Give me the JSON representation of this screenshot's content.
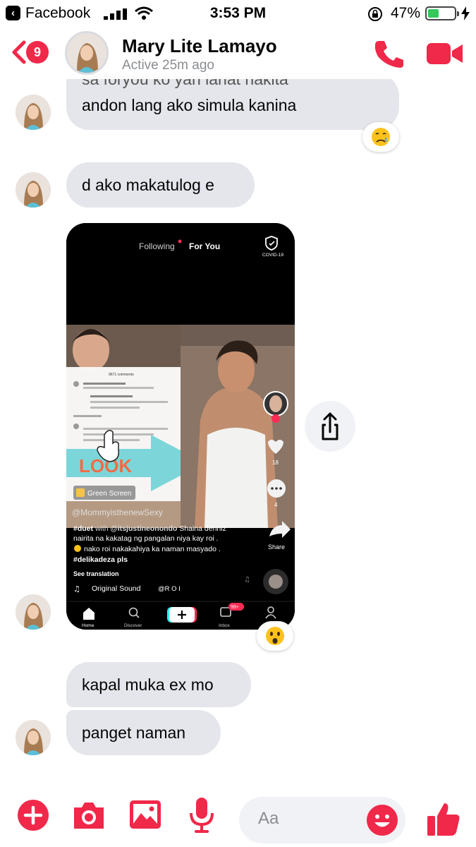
{
  "status_bar": {
    "back_app": "Facebook",
    "time": "3:53 PM",
    "battery_percent": "47%",
    "battery_level": 0.47,
    "icons": [
      "back-arrow-icon",
      "signal-icon",
      "wifi-icon",
      "orientation-lock-icon",
      "battery-icon",
      "charging-bolt-icon"
    ]
  },
  "header": {
    "back_badge": "9",
    "contact_name": "Mary Lite Lamayo",
    "active_status": "Active 25m ago",
    "icons": [
      "chevron-left-icon",
      "phone-icon",
      "video-camera-icon"
    ]
  },
  "messages": [
    {
      "id": "m1",
      "lines": [
        "sa foryou ko yan lahat nakita",
        "andon lang ako simula kanina"
      ],
      "reaction": "crying-face-emoji"
    },
    {
      "id": "m2",
      "lines": [
        "d ako makatulog e"
      ]
    },
    {
      "id": "m3",
      "type": "image",
      "reaction": "astonished-face-emoji"
    },
    {
      "id": "m4",
      "lines": [
        "kapal muka ex mo"
      ]
    },
    {
      "id": "m5",
      "lines": [
        "panget naman"
      ]
    }
  ],
  "tiktok": {
    "tab_following": "Following",
    "tab_for_you": "For You",
    "covid_label": "COVID-19",
    "comments_count": "9671 comments",
    "look_text": "LOOK",
    "green_screen": "Green Screen",
    "handle_overlay": "@MommyisthenewSexy",
    "caption_line1_tag": "#duet",
    "caption_line1_with": "with",
    "caption_line1_mention": "@itsjustineonondo",
    "caption_line1_rest": "Shaina denniz",
    "caption_line2": "nairita na kakatag ng pangalan niya kay roi .",
    "caption_line3": "nako roi nakakahiya ka naman masyado .",
    "caption_line4": "#delikadeza pls",
    "see_translation": "See translation",
    "sound_label": "Original Sound",
    "sound_author": "@R O I",
    "like_count": "18",
    "comment_count": "4",
    "share_label": "Share",
    "nav_home": "Home",
    "nav_discover": "Discover",
    "nav_inbox": "Inbox",
    "inbox_badge": "99+"
  },
  "composer": {
    "placeholder": "Aa",
    "icons": [
      "plus-circle-icon",
      "camera-icon",
      "photo-icon",
      "microphone-icon",
      "emoji-icon",
      "thumbs-up-icon"
    ]
  },
  "colors": {
    "accent": "#f02849",
    "bubble_gray": "#e4e6eb",
    "secondary_text": "#8a8d91"
  }
}
